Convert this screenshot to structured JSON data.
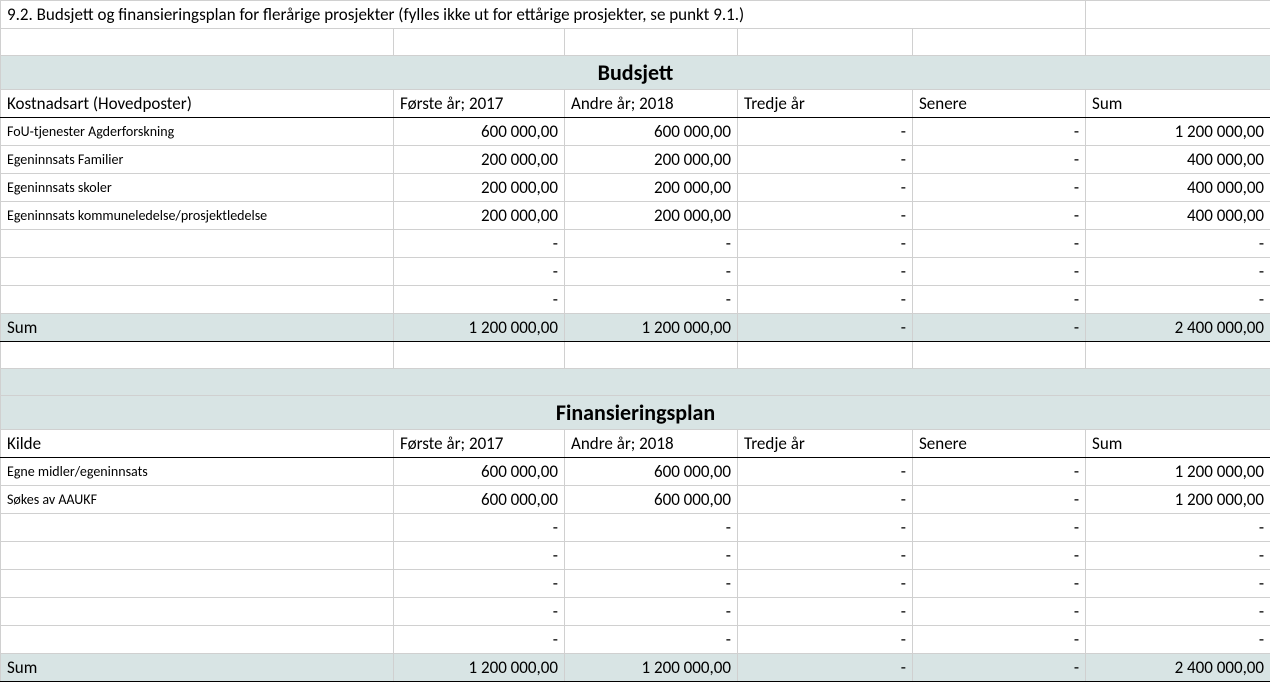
{
  "topHeader": "9.2. Budsjett og finansieringsplan for flerårige prosjekter (fylles ikke ut for ettårige prosjekter, se punkt 9.1.)",
  "budsjett": {
    "title": "Budsjett",
    "headers": [
      "Kostnadsart (Hovedposter)",
      "Første år; 2017",
      "Andre år; 2018",
      "Tredje år",
      "Senere",
      "Sum"
    ],
    "rows": [
      {
        "label": "FoU-tjenester Agderforskning",
        "y1": "600 000,00",
        "y2": "600 000,00",
        "y3": "-",
        "later": "-",
        "sum": "1 200 000,00"
      },
      {
        "label": "Egeninnsats Familier",
        "y1": "200 000,00",
        "y2": "200 000,00",
        "y3": "-",
        "later": "-",
        "sum": "400 000,00"
      },
      {
        "label": "Egeninnsats skoler",
        "y1": "200 000,00",
        "y2": "200 000,00",
        "y3": "-",
        "later": "-",
        "sum": "400 000,00"
      },
      {
        "label": "Egeninnsats kommuneledelse/prosjektledelse",
        "y1": "200 000,00",
        "y2": "200 000,00",
        "y3": "-",
        "later": "-",
        "sum": "400 000,00"
      },
      {
        "label": "",
        "y1": "-",
        "y2": "-",
        "y3": "-",
        "later": "-",
        "sum": "-"
      },
      {
        "label": "",
        "y1": "-",
        "y2": "-",
        "y3": "-",
        "later": "-",
        "sum": "-"
      },
      {
        "label": "",
        "y1": "-",
        "y2": "-",
        "y3": "-",
        "later": "-",
        "sum": "-"
      }
    ],
    "sum": {
      "label": "Sum",
      "y1": "1 200 000,00",
      "y2": "1 200 000,00",
      "y3": "-",
      "later": "-",
      "sum": "2 400 000,00"
    }
  },
  "finans": {
    "title": "Finansieringsplan",
    "headers": [
      "Kilde",
      "Første år; 2017",
      "Andre år; 2018",
      "Tredje år",
      "Senere",
      "Sum"
    ],
    "rows": [
      {
        "label": "Egne midler/egeninnsats",
        "y1": "600 000,00",
        "y2": "600 000,00",
        "y3": "-",
        "later": "-",
        "sum": "1 200 000,00"
      },
      {
        "label": "Søkes av AAUKF",
        "y1": "600 000,00",
        "y2": "600 000,00",
        "y3": "-",
        "later": "-",
        "sum": "1 200 000,00"
      },
      {
        "label": "",
        "y1": "-",
        "y2": "-",
        "y3": "-",
        "later": "-",
        "sum": "-"
      },
      {
        "label": "",
        "y1": "-",
        "y2": "-",
        "y3": "-",
        "later": "-",
        "sum": "-"
      },
      {
        "label": "",
        "y1": "-",
        "y2": "-",
        "y3": "-",
        "later": "-",
        "sum": "-"
      },
      {
        "label": "",
        "y1": "-",
        "y2": "-",
        "y3": "-",
        "later": "-",
        "sum": "-"
      },
      {
        "label": "",
        "y1": "-",
        "y2": "-",
        "y3": "-",
        "later": "-",
        "sum": "-"
      }
    ],
    "sum": {
      "label": "Sum",
      "y1": "1 200 000,00",
      "y2": "1 200 000,00",
      "y3": "-",
      "later": "-",
      "sum": "2 400 000,00"
    }
  }
}
